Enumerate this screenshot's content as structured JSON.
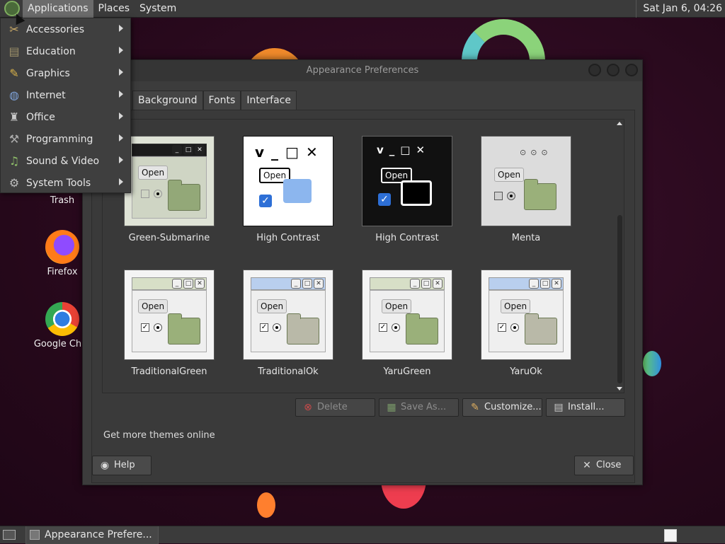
{
  "top_panel": {
    "menus": [
      "Applications",
      "Places",
      "System"
    ],
    "clock": "Sat Jan  6, 04:26"
  },
  "apps_menu": {
    "items": [
      {
        "label": "Accessories",
        "icon": "accessories-icon"
      },
      {
        "label": "Education",
        "icon": "education-icon"
      },
      {
        "label": "Graphics",
        "icon": "graphics-icon"
      },
      {
        "label": "Internet",
        "icon": "internet-icon"
      },
      {
        "label": "Office",
        "icon": "office-icon"
      },
      {
        "label": "Programming",
        "icon": "programming-icon"
      },
      {
        "label": "Sound & Video",
        "icon": "sound-video-icon"
      },
      {
        "label": "System Tools",
        "icon": "system-tools-icon"
      }
    ]
  },
  "desktop_icons": [
    {
      "label": "Trash",
      "icon": "trash-icon"
    },
    {
      "label": "Firefox",
      "icon": "firefox-icon"
    },
    {
      "label": "Google Chro",
      "icon": "chrome-icon"
    }
  ],
  "dialog": {
    "title": "Appearance Preferences",
    "tabs": [
      "Background",
      "Fonts",
      "Interface"
    ],
    "themes": [
      {
        "name": "Green-Submarine",
        "style": "dark-green"
      },
      {
        "name": "High Contrast",
        "style": "high-contrast"
      },
      {
        "name": "High Contrast",
        "style": "high-contrast-inverse"
      },
      {
        "name": "Menta",
        "style": "menta"
      },
      {
        "name": "TraditionalGreen",
        "style": "traditional-green"
      },
      {
        "name": "TraditionalOk",
        "style": "traditional-ok"
      },
      {
        "name": "YaruGreen",
        "style": "yaru-green"
      },
      {
        "name": "YaruOk",
        "style": "yaru-ok"
      }
    ],
    "thumb_text": "Open",
    "buttons": {
      "delete": "Delete",
      "save_as": "Save As...",
      "customize": "Customize...",
      "install": "Install...",
      "help": "Help",
      "close": "Close"
    },
    "more_themes": "Get more themes online"
  },
  "taskbar": {
    "task": "Appearance Prefere..."
  },
  "colors": {
    "panel": "#3b3b3b",
    "dialog": "#3c3c3c",
    "folder_green": "#9ab07a"
  }
}
